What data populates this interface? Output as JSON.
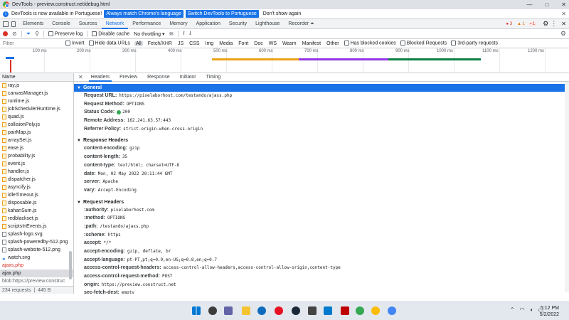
{
  "window": {
    "title": "DevTools - preview.construct.net/debug.html",
    "minimize": "—",
    "maximize": "□",
    "close": "✕"
  },
  "infobar": {
    "message": "DevTools is now available in Portuguese!",
    "btn_match": "Always match Chrome's language",
    "btn_switch": "Switch DevTools to Portuguese",
    "btn_dismiss": "Don't show again",
    "close": "✕"
  },
  "tabs": {
    "items": [
      "Elements",
      "Console",
      "Sources",
      "Network",
      "Performance",
      "Memory",
      "Application",
      "Security",
      "Lighthouse",
      "Recorder ⏶"
    ],
    "active": "Network",
    "errors": "3",
    "warnings": "1",
    "issues": "1"
  },
  "toolbar": {
    "preserve_log": "Preserve log",
    "disable_cache": "Disable cache",
    "throttling": "No throttling"
  },
  "filterbar": {
    "placeholder": "Filter",
    "invert": "Invert",
    "hide_data_urls": "Hide data URLs",
    "types": [
      "All",
      "Fetch/XHR",
      "JS",
      "CSS",
      "Img",
      "Media",
      "Font",
      "Doc",
      "WS",
      "Wasm",
      "Manifest",
      "Other"
    ],
    "blocked_cookies": "Has blocked cookies",
    "blocked_requests": "Blocked Requests",
    "third_party": "3rd-party requests"
  },
  "timeline": {
    "ticks": [
      "100 ms",
      "200 ms",
      "300 ms",
      "400 ms",
      "500 ms",
      "600 ms",
      "700 ms",
      "800 ms",
      "900 ms",
      "1000 ms",
      "1100 ms",
      "1200 ms"
    ]
  },
  "requests": {
    "header": "Name",
    "items": [
      {
        "name": "ray.js",
        "kind": "js"
      },
      {
        "name": "canvasManager.js",
        "kind": "js"
      },
      {
        "name": "runtime.js",
        "kind": "js"
      },
      {
        "name": "jobSchedulerRuntime.js",
        "kind": "js"
      },
      {
        "name": "quad.js",
        "kind": "js"
      },
      {
        "name": "collisionPoly.js",
        "kind": "js"
      },
      {
        "name": "pairMap.js",
        "kind": "js"
      },
      {
        "name": "arraySet.js",
        "kind": "js"
      },
      {
        "name": "ease.js",
        "kind": "js"
      },
      {
        "name": "probability.js",
        "kind": "js"
      },
      {
        "name": "event.js",
        "kind": "js"
      },
      {
        "name": "handler.js",
        "kind": "js"
      },
      {
        "name": "dispatcher.js",
        "kind": "js"
      },
      {
        "name": "asyncify.js",
        "kind": "js"
      },
      {
        "name": "idleTimeout.js",
        "kind": "js"
      },
      {
        "name": "disposable.js",
        "kind": "js"
      },
      {
        "name": "kahanSum.js",
        "kind": "js"
      },
      {
        "name": "redblackset.js",
        "kind": "js"
      },
      {
        "name": "scriptsInEvents.js",
        "kind": "js"
      },
      {
        "name": "splash-logo.svg",
        "kind": "plain"
      },
      {
        "name": "splash-poweredby-512.png",
        "kind": "plain"
      },
      {
        "name": "splash-website-512.png",
        "kind": "plain"
      },
      {
        "name": "watch.svg",
        "kind": "watch"
      },
      {
        "name": "ajaxs.php",
        "kind": "red"
      },
      {
        "name": "ajax.php",
        "kind": "sel"
      },
      {
        "name": "blob:https://preview.construc",
        "kind": "blob"
      }
    ],
    "footer_count": "234 requests",
    "footer_size": "445 B transferred"
  },
  "detail": {
    "tabs": [
      "Headers",
      "Preview",
      "Response",
      "Initiator",
      "Timing"
    ],
    "active_tab": "Headers",
    "general": {
      "title": "General",
      "rows": [
        {
          "k": "Request URL:",
          "v": "https://pixelaborhost.com/testando/ajaxs.php"
        },
        {
          "k": "Request Method:",
          "v": "OPTIONS"
        },
        {
          "k": "Status Code:",
          "v": "200"
        },
        {
          "k": "Remote Address:",
          "v": "162.241.63.57:443"
        },
        {
          "k": "Referrer Policy:",
          "v": "strict-origin-when-cross-origin"
        }
      ]
    },
    "response": {
      "title": "Response Headers",
      "rows": [
        {
          "k": "content-encoding:",
          "v": "gzip"
        },
        {
          "k": "content-length:",
          "v": "35"
        },
        {
          "k": "content-type:",
          "v": "text/html; charset=UTF-8"
        },
        {
          "k": "date:",
          "v": "Mon, 02 May 2022 20:11:44 GMT"
        },
        {
          "k": "server:",
          "v": "Apache"
        },
        {
          "k": "vary:",
          "v": "Accept-Encoding"
        }
      ]
    },
    "request": {
      "title": "Request Headers",
      "rows": [
        {
          "k": ":authority:",
          "v": "pixelaborhost.com"
        },
        {
          "k": ":method:",
          "v": "OPTIONS"
        },
        {
          "k": ":path:",
          "v": "/testando/ajaxs.php"
        },
        {
          "k": ":scheme:",
          "v": "https"
        },
        {
          "k": "accept:",
          "v": "*/*"
        },
        {
          "k": "accept-encoding:",
          "v": "gzip, deflate, br"
        },
        {
          "k": "accept-language:",
          "v": "pt-PT,pt;q=0.9,en-US;q=0.8,en;q=0.7"
        },
        {
          "k": "access-control-request-headers:",
          "v": "access-control-allow-headers,access-control-allow-origin,content-type"
        },
        {
          "k": "access-control-request-method:",
          "v": "POST"
        },
        {
          "k": "origin:",
          "v": "https://preview.construct.net"
        },
        {
          "k": "sec-fetch-dest:",
          "v": "empty"
        }
      ]
    }
  },
  "taskbar": {
    "time": "5:12 PM",
    "date": "5/2/2022"
  }
}
